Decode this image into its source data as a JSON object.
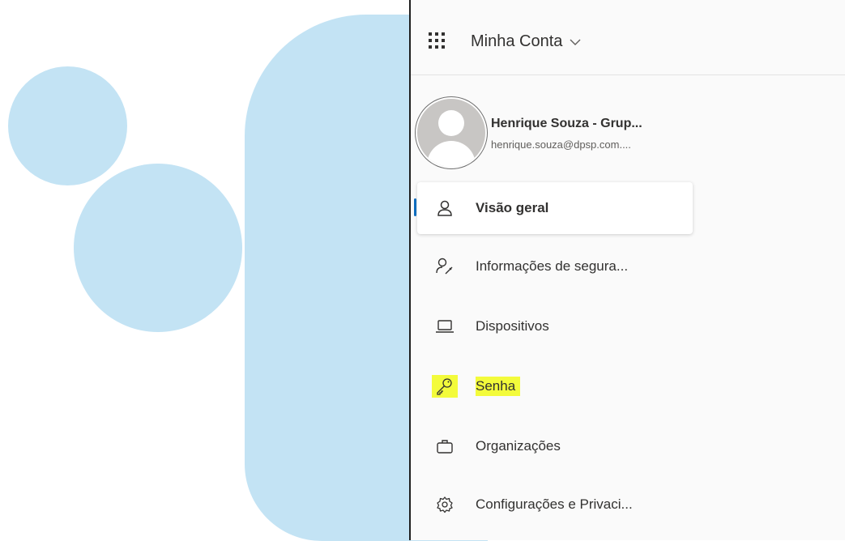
{
  "header": {
    "app_title": "Minha Conta"
  },
  "profile": {
    "name": "Henrique Souza - Grup...",
    "email": "henrique.souza@dpsp.com...."
  },
  "nav": {
    "items": [
      {
        "label": "Visão geral",
        "icon": "person-icon",
        "active": true
      },
      {
        "label": "Informações de segura...",
        "icon": "person-key-icon"
      },
      {
        "label": "Dispositivos",
        "icon": "laptop-icon"
      },
      {
        "label": "Senha",
        "icon": "key-icon",
        "highlighted": true
      },
      {
        "label": "Organizações",
        "icon": "briefcase-icon"
      },
      {
        "label": "Configurações e Privaci...",
        "icon": "gear-icon"
      }
    ]
  },
  "colors": {
    "decor_blue": "#c3e3f4",
    "accent": "#0f6cbd",
    "highlight": "#f3fb3b"
  }
}
